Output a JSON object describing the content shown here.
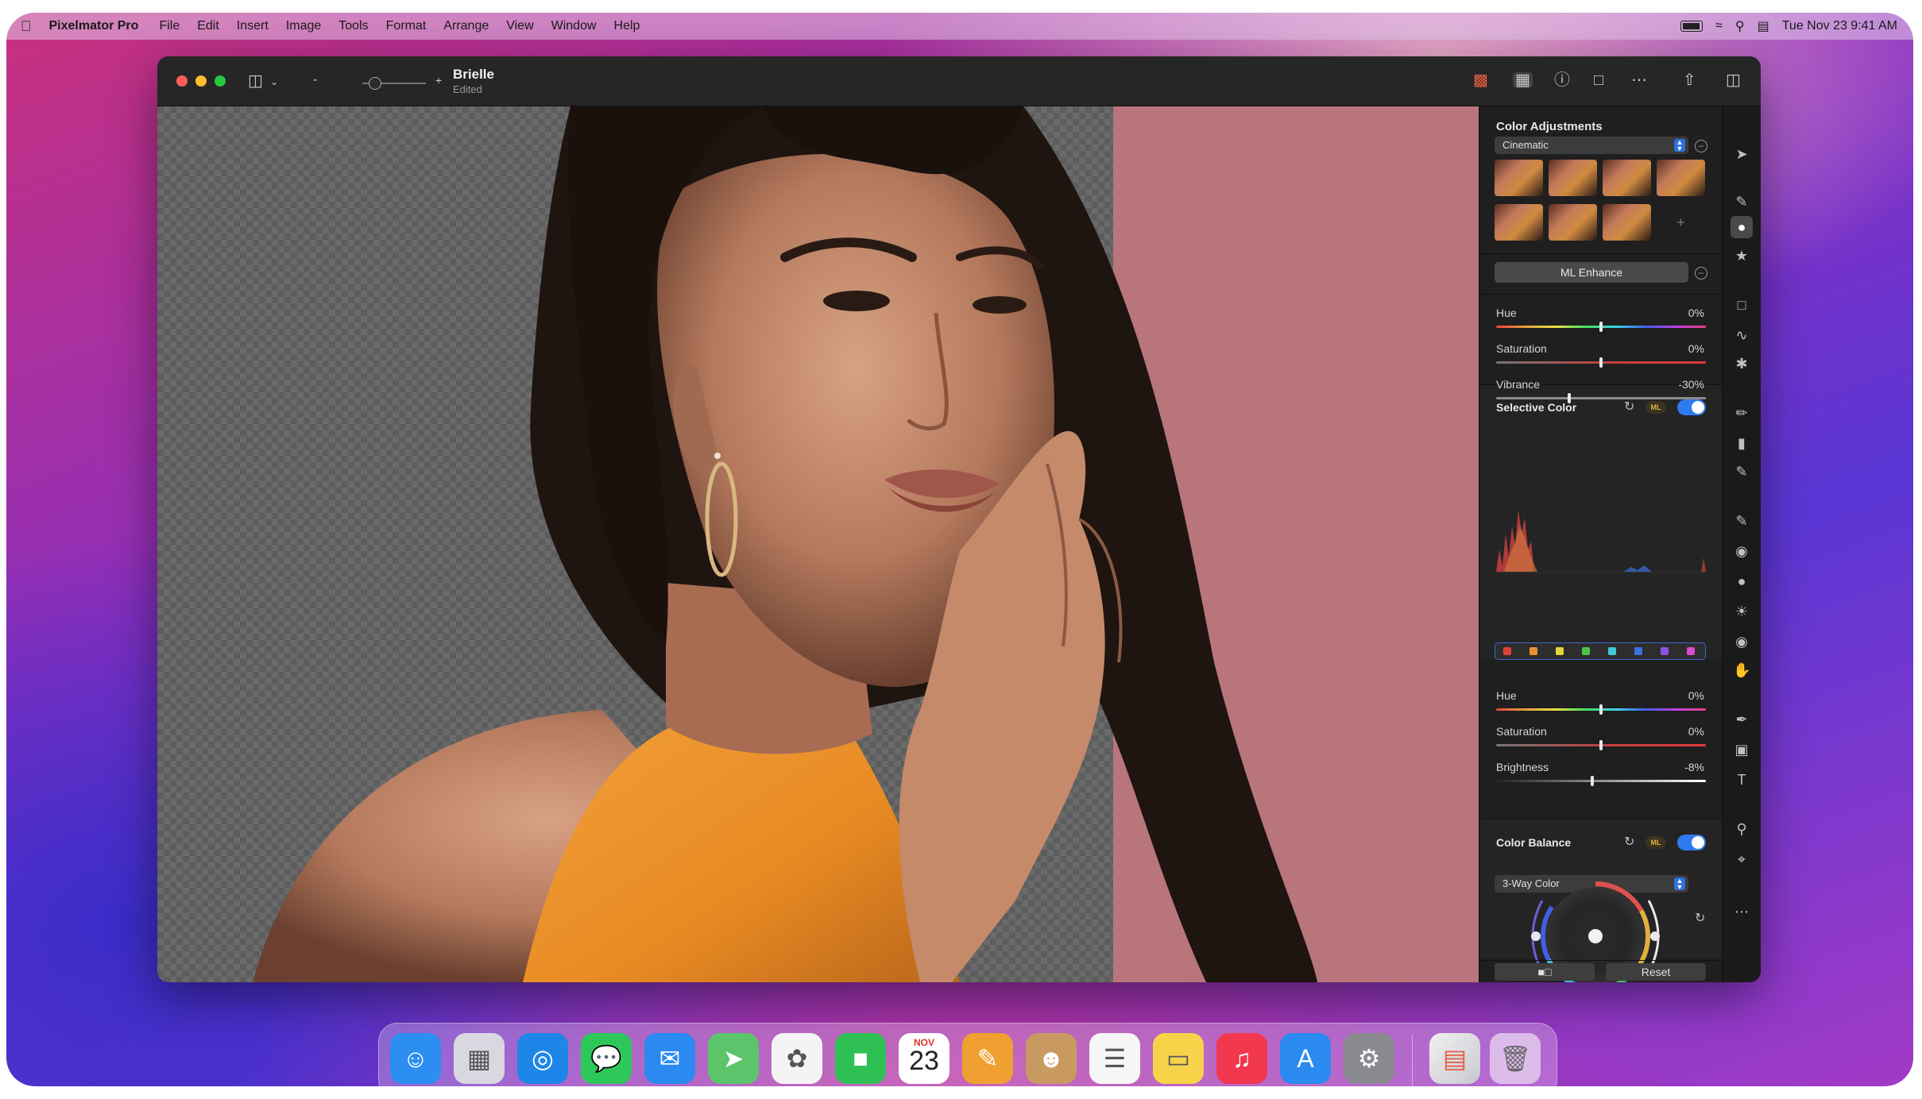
{
  "menubar": {
    "app_name": "Pixelmator Pro",
    "items": [
      "File",
      "Edit",
      "Insert",
      "Image",
      "Tools",
      "Format",
      "Arrange",
      "View",
      "Window",
      "Help"
    ],
    "clock": "Tue Nov 23  9:41 AM"
  },
  "window": {
    "doc_title": "Brielle",
    "doc_subtitle": "Edited",
    "zoom_minus": "-",
    "zoom_plus": "+"
  },
  "sidebar": {
    "title": "Color Adjustments",
    "preset_dropdown": "Cinematic",
    "ml_enhance_label": "ML Enhance",
    "adjust_sliders": [
      {
        "label": "Hue",
        "value": "0%",
        "position": 0.5,
        "style": "hue"
      },
      {
        "label": "Saturation",
        "value": "0%",
        "position": 0.5,
        "style": "sat"
      },
      {
        "label": "Vibrance",
        "value": "-30%",
        "position": 0.35,
        "style": "vib"
      }
    ],
    "selective_color": {
      "title": "Selective Color",
      "ml_badge": "ML",
      "enabled": true,
      "swatch_colors": [
        "#e2403a",
        "#e8922f",
        "#e3d43a",
        "#4cc14a",
        "#3fc8d6",
        "#3a70e0",
        "#8a52e0",
        "#d64ad2"
      ],
      "sliders": [
        {
          "label": "Hue",
          "value": "0%",
          "position": 0.5,
          "style": "hue"
        },
        {
          "label": "Saturation",
          "value": "0%",
          "position": 0.5,
          "style": "sat"
        },
        {
          "label": "Brightness",
          "value": "-8%",
          "position": 0.46,
          "style": "bri"
        }
      ]
    },
    "color_balance": {
      "title": "Color Balance",
      "ml_badge": "ML",
      "enabled": true,
      "mode_dropdown": "3-Way Color"
    },
    "reset_label": "Reset"
  },
  "dock": {
    "apps": [
      {
        "name": "Finder",
        "glyph": "☺",
        "color": "#2c8ef0",
        "running": true
      },
      {
        "name": "Launchpad",
        "glyph": "▦",
        "color": "#d8d8e0",
        "running": false
      },
      {
        "name": "Safari",
        "glyph": "◎",
        "color": "#1d86e8",
        "running": false
      },
      {
        "name": "Messages",
        "glyph": "💬",
        "color": "#2ec85a",
        "running": false
      },
      {
        "name": "Mail",
        "glyph": "✉",
        "color": "#2a8af0",
        "running": false
      },
      {
        "name": "Maps",
        "glyph": "➤",
        "color": "#5cc46a",
        "running": false
      },
      {
        "name": "Photos",
        "glyph": "✿",
        "color": "#f4f4f4",
        "running": false
      },
      {
        "name": "FaceTime",
        "glyph": "■",
        "color": "#2fc054",
        "running": false
      },
      {
        "name": "Calendar",
        "glyph": "23",
        "color": "#ffffff",
        "running": false
      },
      {
        "name": "Pixelmator Pro",
        "glyph": "✎",
        "color": "#f0a030",
        "running": true
      },
      {
        "name": "Contacts",
        "glyph": "☻",
        "color": "#c89a62",
        "running": false
      },
      {
        "name": "Reminders",
        "glyph": "☰",
        "color": "#f6f6f6",
        "running": false
      },
      {
        "name": "Notes",
        "glyph": "▭",
        "color": "#f7d34a",
        "running": false
      },
      {
        "name": "Music",
        "glyph": "♫",
        "color": "#f2384e",
        "running": false
      },
      {
        "name": "App Store",
        "glyph": "A",
        "color": "#2a8af0",
        "running": false
      },
      {
        "name": "System Preferences",
        "glyph": "⚙",
        "color": "#8a8a90",
        "running": false
      }
    ],
    "calendar_month": "NOV",
    "calendar_day": "23"
  }
}
